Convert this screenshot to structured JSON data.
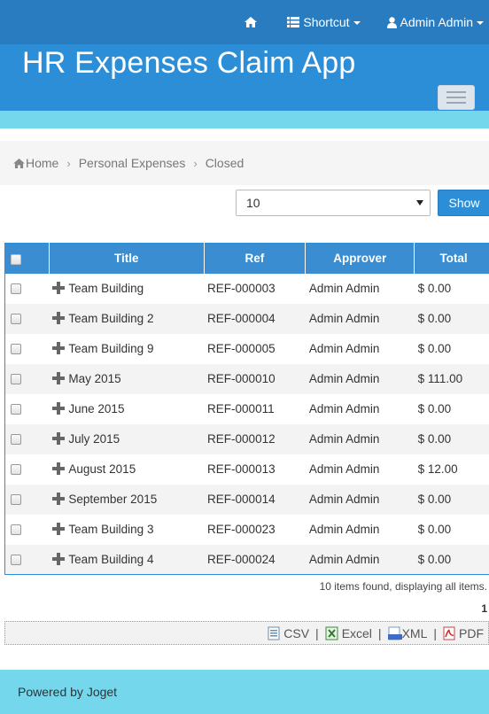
{
  "topnav": {
    "home_icon": "home-icon",
    "shortcut_label": "Shortcut",
    "shortcut_icon": "list-icon",
    "user_label": "Admin Admin",
    "user_icon": "user-icon"
  },
  "header": {
    "title": "HR Expenses Claim App"
  },
  "colors": {
    "header_blue": "#2c8ed6",
    "topbar_blue": "#2a7cc0",
    "accent_cyan": "#74d7ec",
    "table_header": "#3a8dd0"
  },
  "breadcrumb": {
    "items": [
      "Home",
      "Personal Expenses",
      "Closed"
    ]
  },
  "pager": {
    "selected": "10",
    "show_label": "Show"
  },
  "table": {
    "columns": [
      "Title",
      "Ref",
      "Approver",
      "Total"
    ],
    "rows": [
      {
        "title": "Team Building",
        "ref": "REF-000003",
        "approver": "Admin Admin",
        "total": "$ 0.00"
      },
      {
        "title": "Team Building 2",
        "ref": "REF-000004",
        "approver": "Admin Admin",
        "total": "$ 0.00"
      },
      {
        "title": "Team Building 9",
        "ref": "REF-000005",
        "approver": "Admin Admin",
        "total": "$ 0.00"
      },
      {
        "title": "May 2015",
        "ref": "REF-000010",
        "approver": "Admin Admin",
        "total": "$ 111.00"
      },
      {
        "title": "June 2015",
        "ref": "REF-000011",
        "approver": "Admin Admin",
        "total": "$ 0.00"
      },
      {
        "title": "July 2015",
        "ref": "REF-000012",
        "approver": "Admin Admin",
        "total": "$ 0.00"
      },
      {
        "title": "August 2015",
        "ref": "REF-000013",
        "approver": "Admin Admin",
        "total": "$ 12.00"
      },
      {
        "title": "September 2015",
        "ref": "REF-000014",
        "approver": "Admin Admin",
        "total": "$ 0.00"
      },
      {
        "title": "Team Building 3",
        "ref": "REF-000023",
        "approver": "Admin Admin",
        "total": "$ 0.00"
      },
      {
        "title": "Team Building 4",
        "ref": "REF-000024",
        "approver": "Admin Admin",
        "total": "$ 0.00"
      }
    ]
  },
  "status": {
    "items_found": "10 items found, displaying all items.",
    "page": "1"
  },
  "export": {
    "csv": "CSV",
    "excel": "Excel",
    "xml": "XML",
    "pdf": "PDF",
    "separator": "|"
  },
  "footer": {
    "text": "Powered by Joget"
  }
}
